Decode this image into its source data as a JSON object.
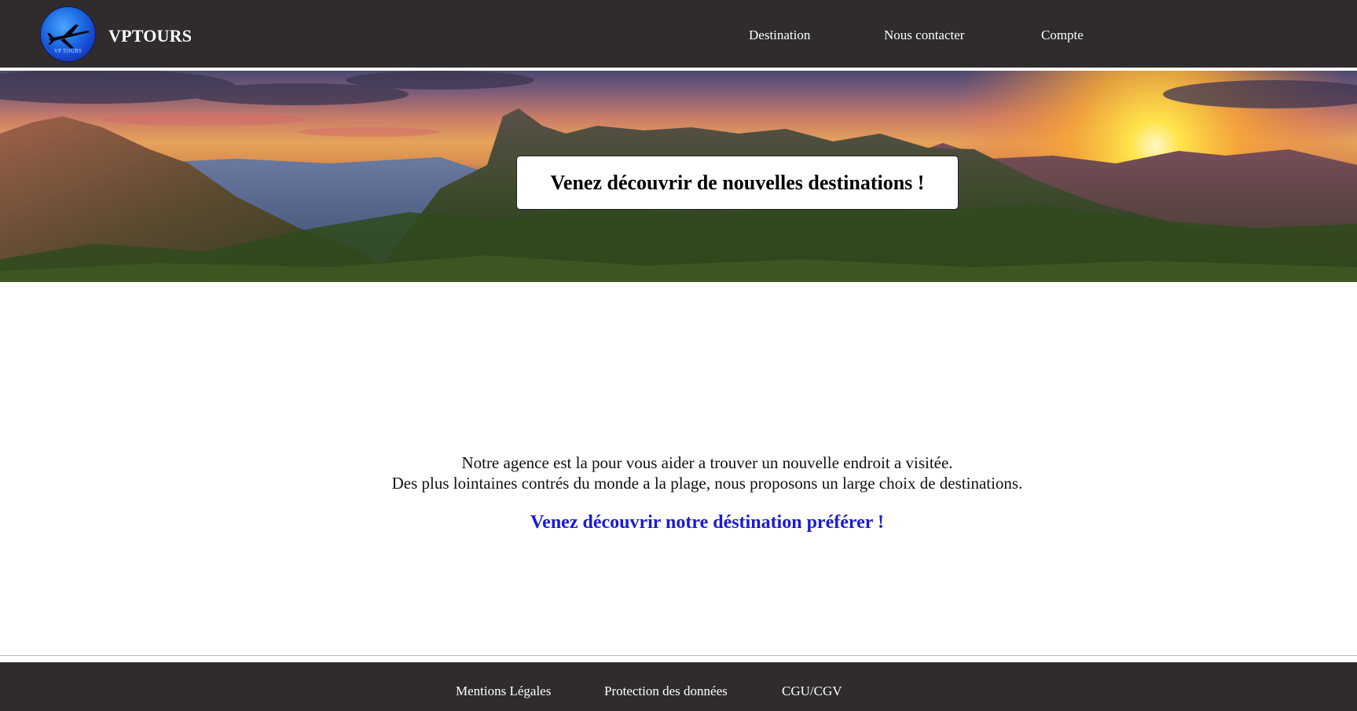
{
  "header": {
    "brand": "VPTOURS",
    "logo_caption": "VP TOURS",
    "nav": [
      {
        "label": "Destination"
      },
      {
        "label": "Nous contacter"
      },
      {
        "label": "Compte"
      }
    ]
  },
  "hero": {
    "title": "Venez découvrir de nouvelles destinations !"
  },
  "main": {
    "intro_line1": "Notre agence est la pour vous aider a trouver un nouvelle endroit a visitée.",
    "intro_line2": "Des plus lointaines contrés du monde a la plage, nous proposons un large choix de destinations.",
    "cta": "Venez découvrir notre déstination préférer !"
  },
  "footer": {
    "links": [
      {
        "label": "Mentions Légales"
      },
      {
        "label": "Protection des données"
      },
      {
        "label": "CGU/CGV"
      }
    ]
  },
  "colors": {
    "header_bg": "#302c2d",
    "cta": "#1a1ad6",
    "text": "#111111"
  }
}
